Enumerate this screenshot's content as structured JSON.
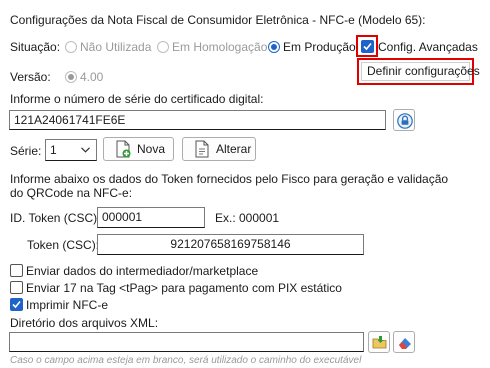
{
  "title": "Configurações da Nota Fiscal de Consumidor Eletrônica - NFC-e (Modelo 65):",
  "situacao": {
    "label": "Situação:",
    "options": [
      "Não Utilizada",
      "Em Homologação",
      "Em Produção"
    ],
    "selected": "Em Produção"
  },
  "config_avancadas": {
    "label": "Config. Avançadas",
    "checked": true,
    "popup_label": "Definir configurações"
  },
  "versao": {
    "label": "Versão:",
    "value": "4.00"
  },
  "certificado": {
    "label": "Informe o número de série do certificado digital:",
    "value": "121A24061741FE6E",
    "icon": "lock-icon"
  },
  "serie": {
    "label": "Série:",
    "value": "1",
    "nova_label": "Nova",
    "alterar_label": "Alterar"
  },
  "token": {
    "info": "Informe abaixo os dados do Token fornecidos pelo Fisco para geração e validação do QRCode na NFC-e:",
    "info_line1": "Informe abaixo os dados do Token fornecidos pelo Fisco para geração e validação",
    "info_line2": "do QRCode na NFC-e:",
    "id_label": "ID. Token (CSC):",
    "id_value": "000001",
    "example": "Ex.: 000001",
    "csc_label": "Token (CSC):",
    "csc_value": "921207658169758146"
  },
  "checkboxes": [
    {
      "label": "Enviar dados do intermediador/marketplace",
      "checked": false
    },
    {
      "label": "Enviar 17 na Tag <tPag> para pagamento com PIX estático",
      "checked": false
    },
    {
      "label": "Imprimir NFC-e",
      "checked": true
    }
  ],
  "diretorio": {
    "label": "Diretório dos arquivos XML:",
    "value": "",
    "placeholder": "Caso o campo acima esteja em branco, será utilizado o caminho do executável"
  },
  "colors": {
    "accent": "#1e63c9",
    "highlight": "#e00000"
  }
}
